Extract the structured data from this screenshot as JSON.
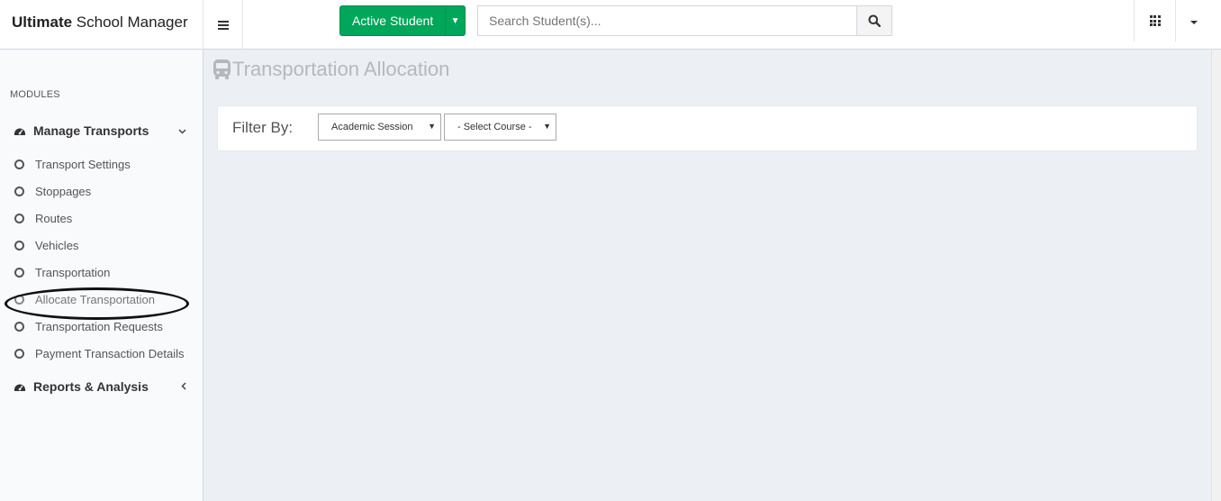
{
  "brand": {
    "bold": "Ultimate",
    "rest": " School Manager"
  },
  "header": {
    "active_button_label": "Active Student",
    "search_placeholder": "Search Student(s)..."
  },
  "sidebar": {
    "modules_label": "MODULES",
    "groups": [
      {
        "label": "Manage Transports",
        "expanded": true,
        "items": [
          {
            "label": "Transport Settings"
          },
          {
            "label": "Stoppages"
          },
          {
            "label": "Routes"
          },
          {
            "label": "Vehicles"
          },
          {
            "label": "Transportation"
          },
          {
            "label": "Allocate Transportation",
            "highlighted": true
          },
          {
            "label": "Transportation Requests"
          },
          {
            "label": "Payment Transaction Details"
          }
        ]
      },
      {
        "label": "Reports & Analysis",
        "expanded": false
      }
    ]
  },
  "page": {
    "title": "Transportation Allocation",
    "filter_label": "Filter By:",
    "session_select": "Academic Session",
    "course_select": "- Select Course -"
  },
  "colors": {
    "primary_green": "#00a65a",
    "background": "#ecf0f5",
    "sidebar": "#f9fafc"
  },
  "icons": {
    "menu": "bars-icon",
    "search": "search-icon",
    "apps": "grid-icon",
    "bus": "bus-icon",
    "dashboard": "dashboard-icon"
  }
}
